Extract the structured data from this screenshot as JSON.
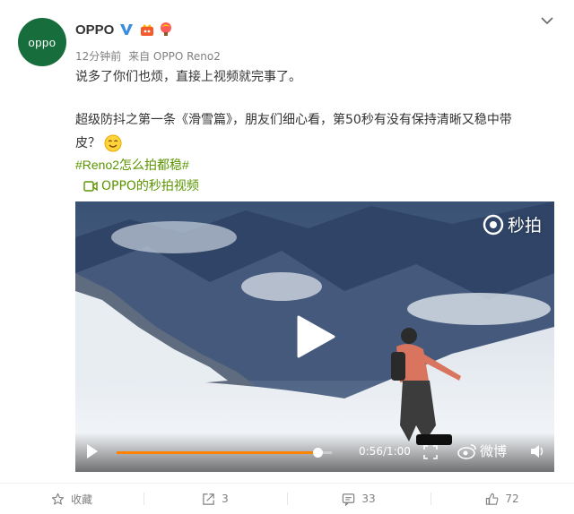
{
  "post": {
    "avatar_text": "oppo",
    "username": "OPPO",
    "time": "12分钟前",
    "source": "来自 OPPO Reno2",
    "text_line1": "说多了你们也烦，直接上视频就完事了。",
    "text_line2": "超级防抖之第一条《滑雪篇》，朋友们细心看，第50秒有没有保持清晰又稳中带",
    "text_line3": "皮？",
    "hashtag": "#Reno2怎么拍都稳#",
    "video_link": "OPPO的秒拍视频",
    "icons": [
      "verified-v-icon",
      "vip-badge-icon",
      "balloon-badge-icon",
      "chevron-down-icon",
      "smile-emoji-icon",
      "video-camera-icon"
    ]
  },
  "video": {
    "watermark": "秒拍",
    "time_display": "0:56/1:00",
    "progress": 0.933,
    "weibo_label": "微博",
    "icons": [
      "play-icon",
      "fullscreen-icon",
      "weibo-logo-icon",
      "volume-icon"
    ]
  },
  "actions": [
    {
      "label": "收藏",
      "icon": "star-icon"
    },
    {
      "label": "3",
      "icon": "repost-icon"
    },
    {
      "label": "33",
      "icon": "comment-icon"
    },
    {
      "label": "72",
      "icon": "like-icon"
    }
  ],
  "colors": {
    "avatar_bg": "#186d3c",
    "link_green": "#5b9500",
    "verified_blue": "#3b8ede",
    "progress_orange": "#ff8200",
    "meta_gray": "#808080"
  }
}
